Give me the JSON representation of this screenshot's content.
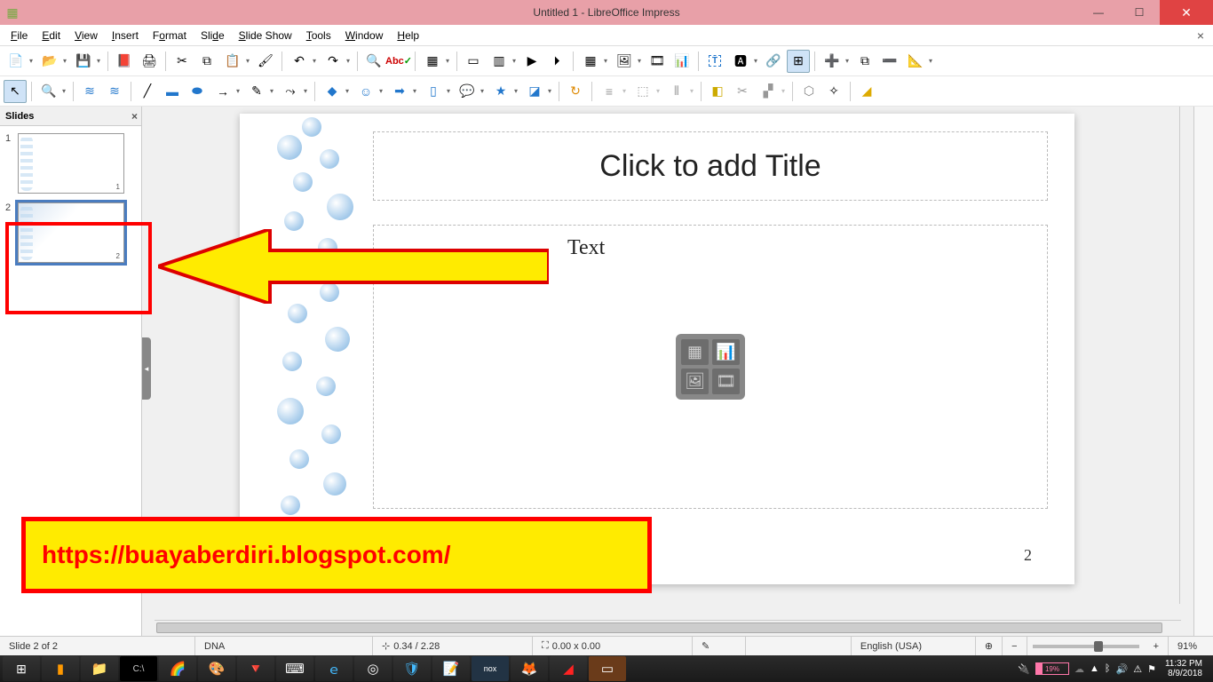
{
  "window": {
    "title": "Untitled 1 - LibreOffice Impress"
  },
  "menu": {
    "items": [
      "File",
      "Edit",
      "View",
      "Insert",
      "Format",
      "Slide",
      "Slide Show",
      "Tools",
      "Window",
      "Help"
    ]
  },
  "slidepanel": {
    "header": "Slides",
    "slides": [
      {
        "num": "1",
        "selected": false,
        "page": "1"
      },
      {
        "num": "2",
        "selected": true,
        "page": "2"
      }
    ]
  },
  "canvas": {
    "title_placeholder": "Click to add Title",
    "content_placeholder_fragment": "Text",
    "page_number": "2"
  },
  "annotation": {
    "url": "https://buayaberdiri.blogspot.com/"
  },
  "status": {
    "slide": "Slide 2 of 2",
    "master": "DNA",
    "pos": "0.34 / 2.28",
    "size": "0.00 x 0.00",
    "lang": "English (USA)",
    "zoom": "91%"
  },
  "system": {
    "battery": "19%",
    "time": "11:32 PM",
    "date": "8/9/2018"
  }
}
